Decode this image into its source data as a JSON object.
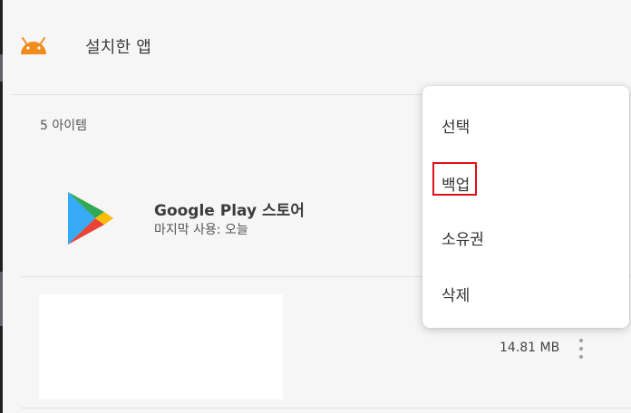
{
  "header": {
    "title": "설치한 앱",
    "icon": "android-icon",
    "icon_color": "#f08b1c"
  },
  "list": {
    "count_label": "5 아이템",
    "apps": [
      {
        "name": "Google Play 스토어",
        "subtitle": "마지막 사용: 오늘",
        "icon": "google-play-icon"
      }
    ],
    "second_item": {
      "size": "14.81 MB"
    }
  },
  "context_menu": {
    "items": [
      {
        "label": "선택"
      },
      {
        "label": "백업",
        "highlighted": true,
        "highlight_color": "#e0101a"
      },
      {
        "label": "소유권"
      },
      {
        "label": "삭제"
      }
    ]
  }
}
